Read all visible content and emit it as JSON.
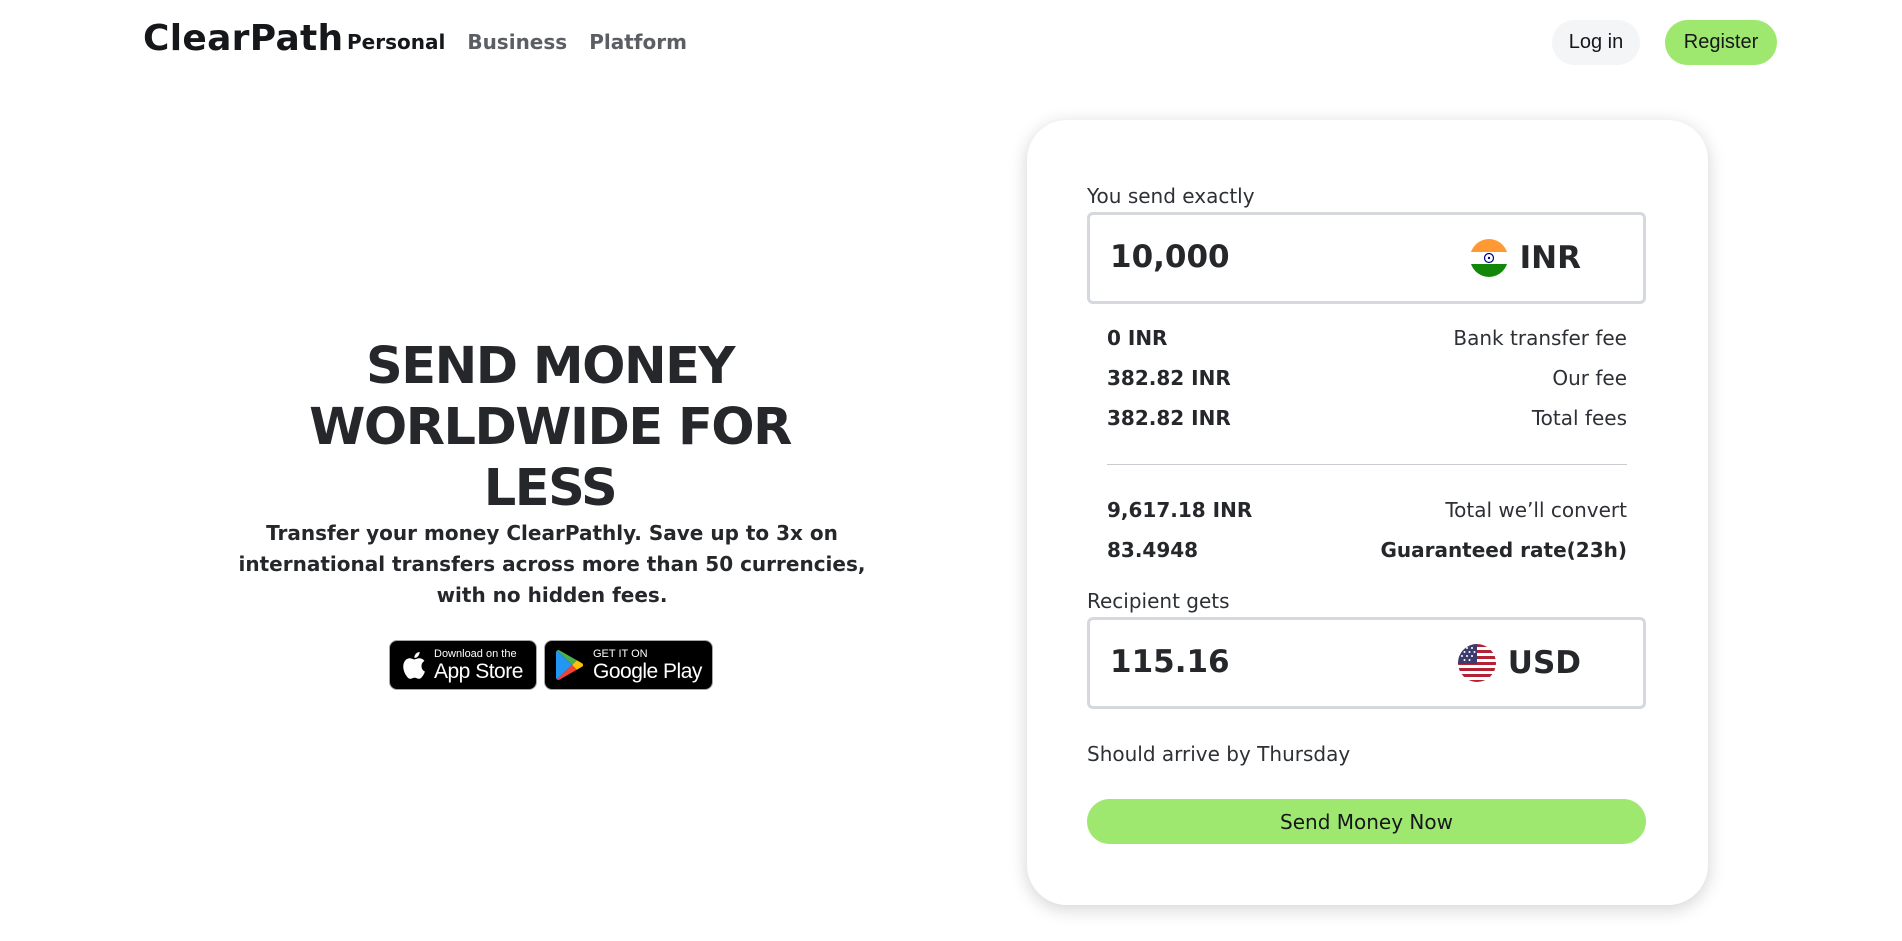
{
  "header": {
    "logo": "ClearPath",
    "nav": [
      "Personal",
      "Business",
      "Platform"
    ],
    "login_label": "Log in",
    "register_label": "Register"
  },
  "hero": {
    "title": "SEND MONEY WORLDWIDE FOR LESS",
    "subtitle": "Transfer your money ClearPathly. Save up to 3x on international transfers across more than 50 currencies, with no hidden fees.",
    "app_store": {
      "small": "Download on the",
      "big": "App Store",
      "icon": "apple-icon"
    },
    "google_play": {
      "small": "GET IT ON",
      "big": "Google Play",
      "icon": "google-play-icon"
    }
  },
  "converter": {
    "send_label": "You send exactly",
    "send_amount": "10,000",
    "send_currency": "INR",
    "send_flag": "india-flag-icon",
    "fees": [
      {
        "amount": "0 INR",
        "label": "Bank transfer fee"
      },
      {
        "amount": "382.82 INR",
        "label": "Our fee"
      },
      {
        "amount": "382.82 INR",
        "label": "Total fees"
      }
    ],
    "convert": {
      "amount": "9,617.18 INR",
      "label": "Total we’ll convert"
    },
    "rate": {
      "amount": "83.4948",
      "label": "Guaranteed rate(23h)"
    },
    "receive_label": "Recipient gets",
    "receive_amount": "115.16",
    "receive_currency": "USD",
    "receive_flag": "us-flag-icon",
    "arrival": "Should arrive by Thursday",
    "cta_label": "Send Money Now"
  },
  "colors": {
    "accent": "#9fe870",
    "text_dark": "#25272b",
    "border": "#d5d8dc"
  }
}
